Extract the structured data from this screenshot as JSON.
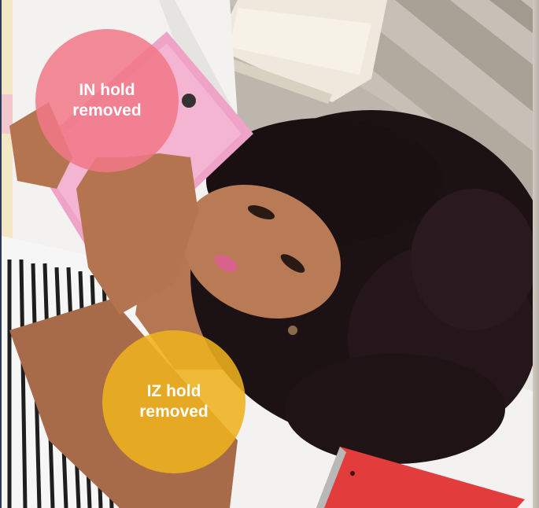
{
  "badges": {
    "in_hold": {
      "line1": "IN hold",
      "line2": "removed",
      "color": "#f07887"
    },
    "iz_hold": {
      "line1": "IZ hold",
      "line2": "removed",
      "color": "#eeb21e"
    }
  },
  "photo": {
    "subject": "woman-lying-in-bed-with-pink-tablet-icon"
  }
}
